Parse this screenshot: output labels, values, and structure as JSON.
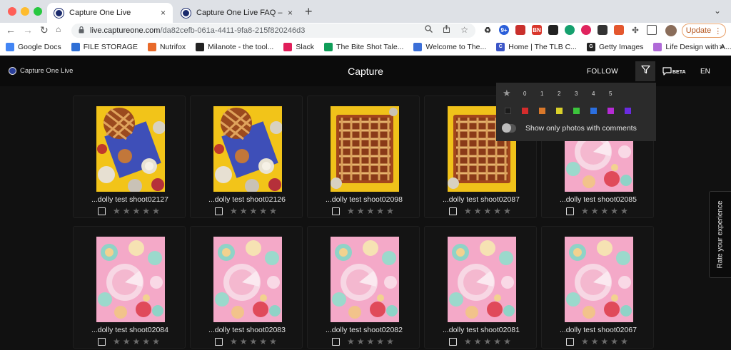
{
  "browser": {
    "tabs": [
      {
        "title": "Capture One Live",
        "close": "×"
      },
      {
        "title": "Capture One Live FAQ – Captu",
        "close": "×"
      }
    ],
    "new_tab": "+",
    "tab_menu": "⌄",
    "back": "←",
    "forward": "→",
    "reload": "↻",
    "url_host": "live.captureone.com",
    "url_path": "/da82cefb-061a-4411-9fa8-215f820246d3",
    "extension_badges": {
      "e2": "9+",
      "e4": "BN"
    },
    "update_label": "Update",
    "update_menu": "⋮"
  },
  "bookmarks": [
    {
      "label": "Google Docs",
      "color": "#4285f4",
      "icon": "docs-icon",
      "glyph": ""
    },
    {
      "label": "FILE STORAGE",
      "color": "#2f6fd6",
      "icon": "storage-icon",
      "glyph": ""
    },
    {
      "label": "Nutrifox",
      "color": "#e86a2a",
      "icon": "fox-icon",
      "glyph": ""
    },
    {
      "label": "Milanote - the tool...",
      "color": "#222222",
      "icon": "milanote-icon",
      "glyph": ""
    },
    {
      "label": "Slack",
      "color": "#e01e5a",
      "icon": "slack-icon",
      "glyph": ""
    },
    {
      "label": "The Bite Shot Tale...",
      "color": "#0f9d58",
      "icon": "sheets-icon",
      "glyph": ""
    },
    {
      "label": "Welcome to The...",
      "color": "#3b6fd8",
      "icon": "welcome-icon",
      "glyph": ""
    },
    {
      "label": "Home | The TLB C...",
      "color": "#3b55c7",
      "icon": "tlb-icon",
      "glyph": "C"
    },
    {
      "label": "Getty Images",
      "color": "#222222",
      "icon": "getty-icon",
      "glyph": "G"
    },
    {
      "label": "Life Design with A...",
      "color": "#b06ad8",
      "icon": "lifedesign-icon",
      "glyph": ""
    }
  ],
  "bookmarks_more": "»",
  "app": {
    "logo_text": "Capture One Live",
    "title": "Capture",
    "follow": "FOLLOW",
    "beta": "BETA",
    "lang": "EN"
  },
  "filter": {
    "star_glyph": "★",
    "ratings": [
      "0",
      "1",
      "2",
      "3",
      "4",
      "5"
    ],
    "colors": [
      "#1a1a1a",
      "#d42c2c",
      "#d9782a",
      "#d9d02a",
      "#3cc43c",
      "#2b6fe0",
      "#b52bd4",
      "#6a2be0"
    ],
    "comments_label": "Show only photos with comments"
  },
  "photos": [
    {
      "name": "...dolly test shoot02127",
      "kind": "pie-blue"
    },
    {
      "name": "...dolly test shoot02126",
      "kind": "pie-blue"
    },
    {
      "name": "...dolly test shoot02098",
      "kind": "pie-lattice"
    },
    {
      "name": "...dolly test shoot02087",
      "kind": "pie-lattice"
    },
    {
      "name": "...dolly test shoot02085",
      "kind": "pink"
    },
    {
      "name": "...dolly test shoot02084",
      "kind": "pink"
    },
    {
      "name": "...dolly test shoot02083",
      "kind": "pink"
    },
    {
      "name": "...dolly test shoot02082",
      "kind": "pink"
    },
    {
      "name": "...dolly test shoot02081",
      "kind": "pink"
    },
    {
      "name": "...dolly test shoot02067",
      "kind": "pink"
    }
  ],
  "star_glyph": "★",
  "rate_label": "Rate your experience"
}
